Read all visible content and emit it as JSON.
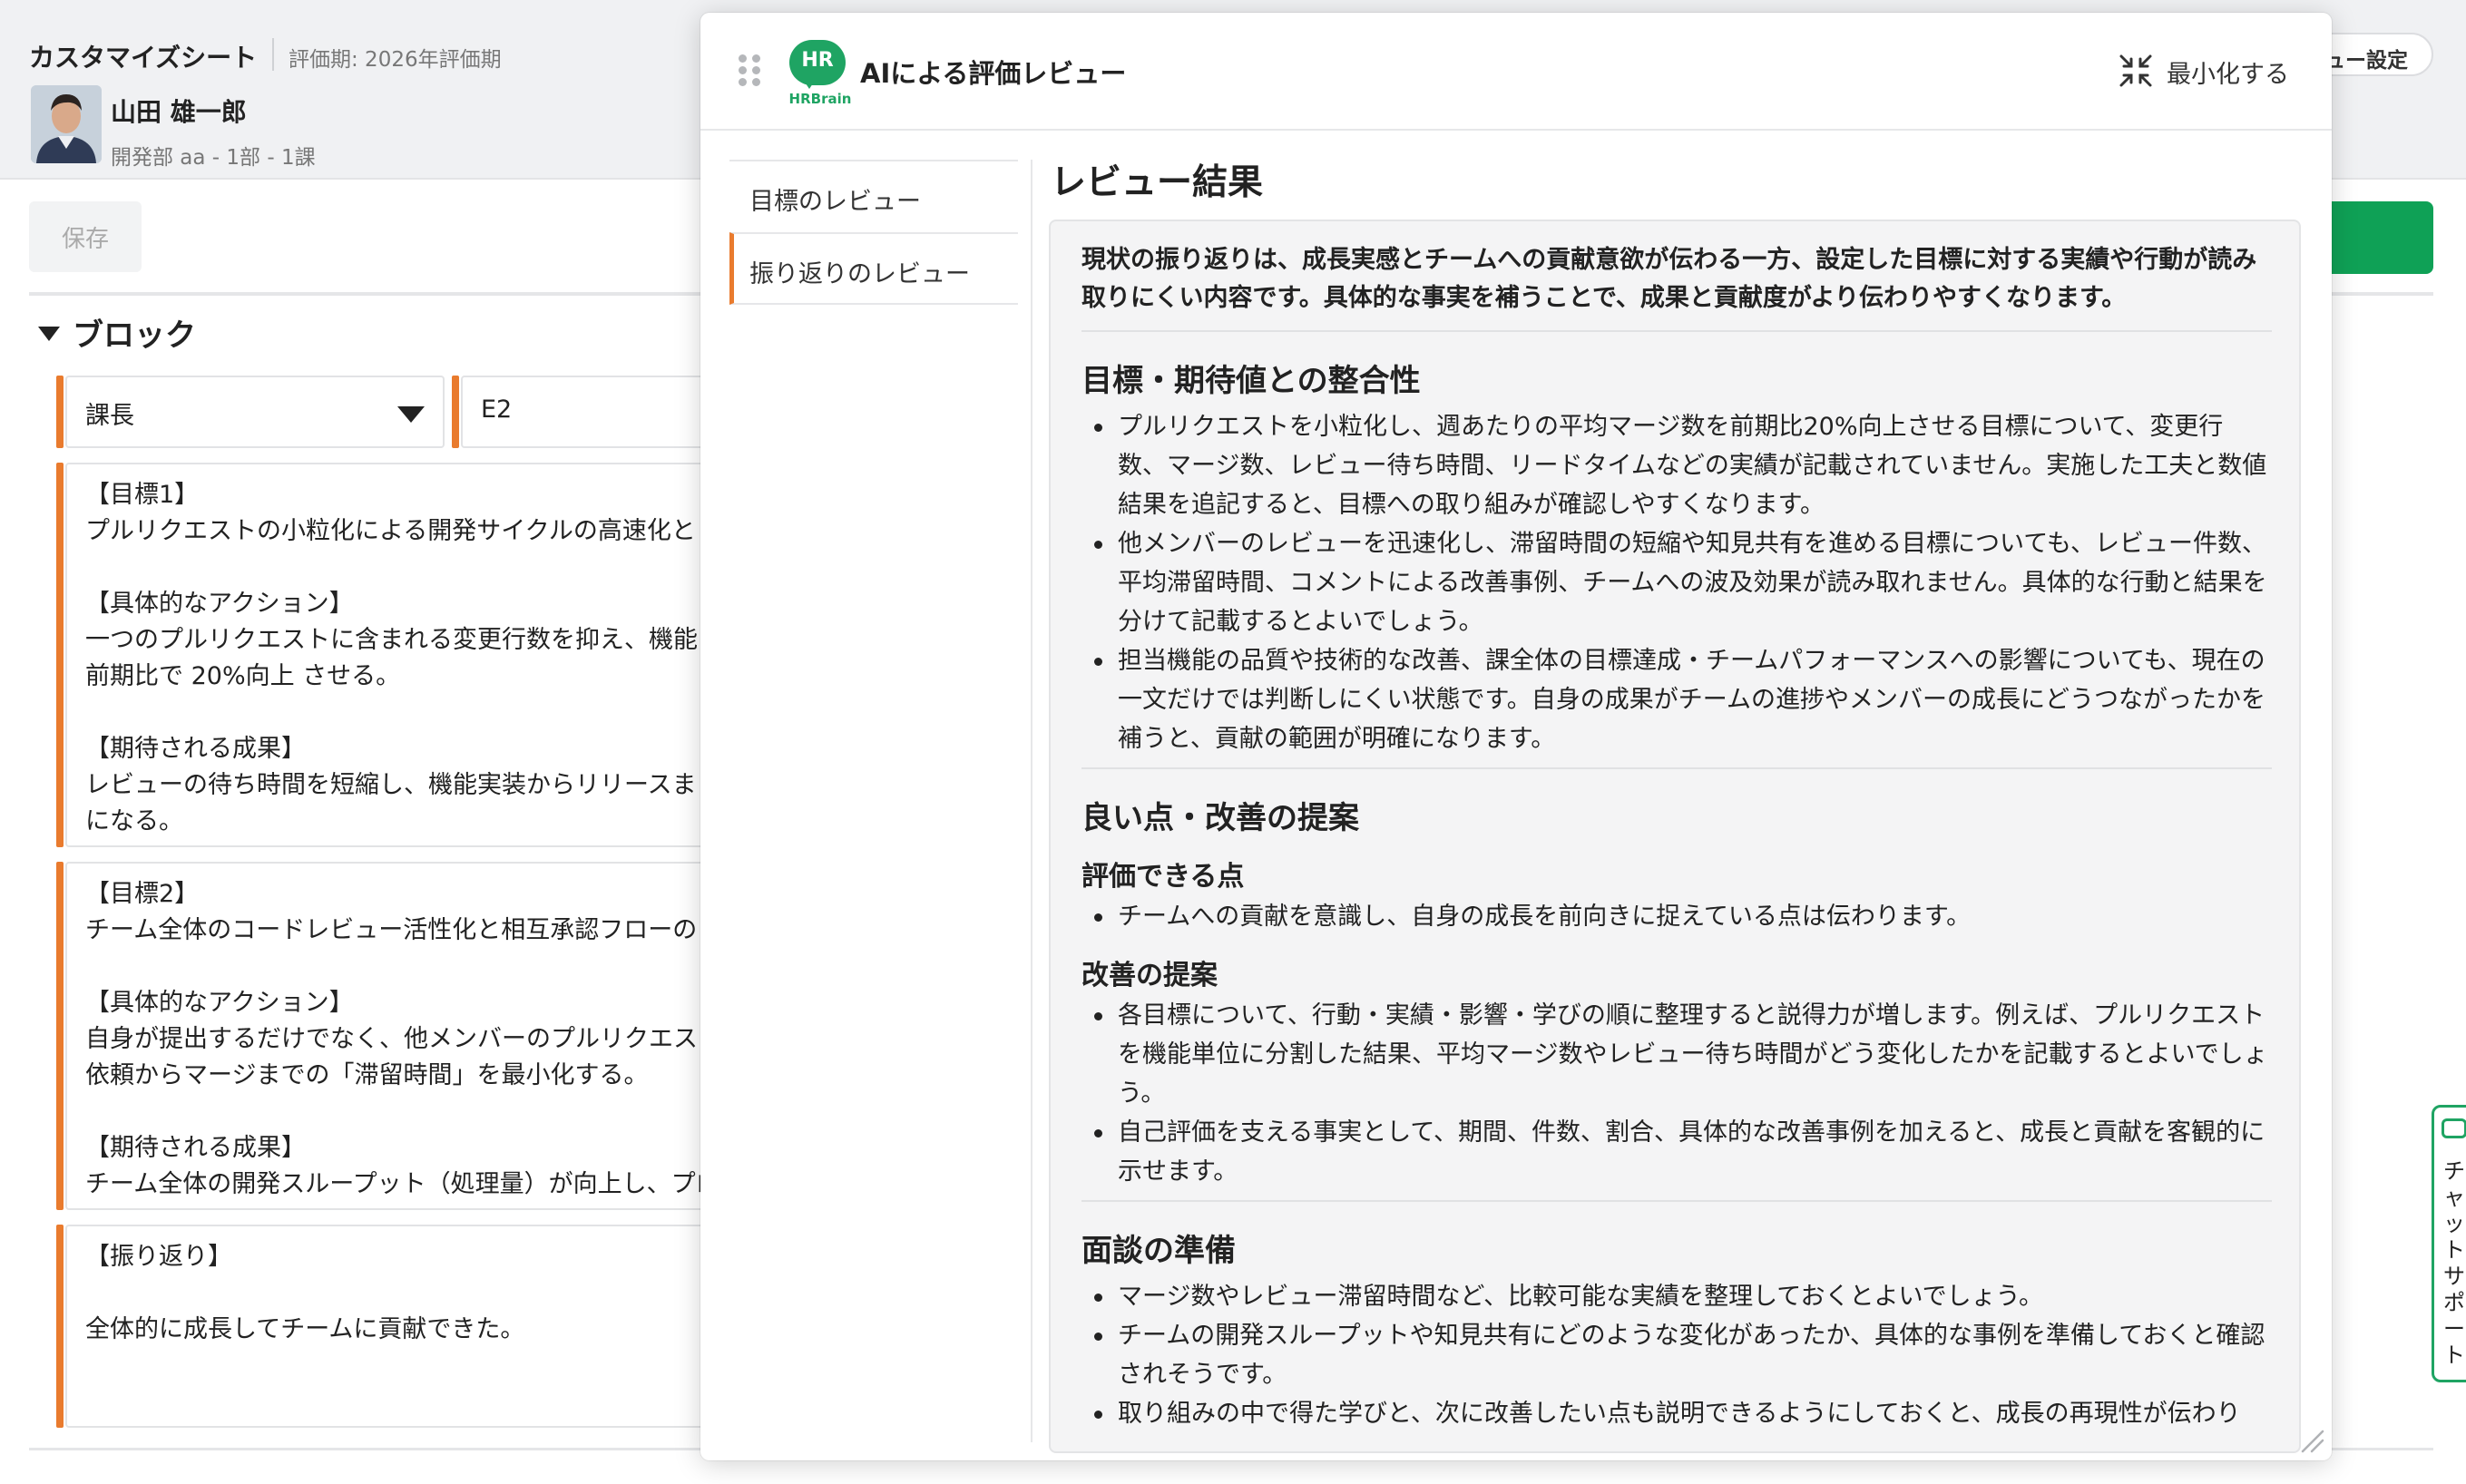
{
  "background_page": {
    "sheet_title": "カスタマイズシート",
    "period_label": "評価期: 2026年評価期",
    "user": {
      "name": "山田 雄一郎",
      "department": "開発部 aa - 1部 - 1課"
    },
    "save_label": "保存",
    "header_right_button_label": "ュー設定",
    "block_title": "ブロック",
    "role_select_value": "課長",
    "grade_value": "E2",
    "goal1_text": "【目標1】\nプルリクエストの小粒化による開発サイクルの高速化と\n\n【具体的なアクション】\n一つのプルリクエストに含まれる変更行数を抑え、機能\n前期比で 20%向上 させる。\n\n【期待される成果】\nレビューの待ち時間を短縮し、機能実装からリリースま\nになる。",
    "goal2_text": "【目標2】\nチーム全体のコードレビュー活性化と相互承認フローの\n\n【具体的なアクション】\n自身が提出するだけでなく、他メンバーのプルリクエス\n依頼からマージまでの「滞留時間」を最小化する。\n\n【期待される成果】\nチーム全体の開発スループット（処理量）が向上し、プロ",
    "reflection_text": "【振り返り】\n\n全体的に成長してチームに貢献できた。",
    "chat_support_label": "チャットサポート"
  },
  "modal": {
    "logo_text": "HR",
    "logo_word": "HRBrain",
    "title": "AIによる評価レビュー",
    "minimize_label": "最小化する",
    "nav_items": [
      {
        "label": "目標のレビュー"
      },
      {
        "label": "振り返りのレビュー"
      }
    ],
    "result_title": "レビュー結果",
    "summary": "現状の振り返りは、成長実感とチームへの貢献意欲が伝わる一方、設定した目標に対する実績や行動が読み取りにくい内容です。具体的な事実を補うことで、成果と貢献度がより伝わりやすくなります。",
    "section1": {
      "title": "目標・期待値との整合性",
      "bullets": [
        "プルリクエストを小粒化し、週あたりの平均マージ数を前期比20%向上させる目標について、変更行数、マージ数、レビュー待ち時間、リードタイムなどの実績が記載されていません。実施した工夫と数値結果を追記すると、目標への取り組みが確認しやすくなります。",
        "他メンバーのレビューを迅速化し、滞留時間の短縮や知見共有を進める目標についても、レビュー件数、平均滞留時間、コメントによる改善事例、チームへの波及効果が読み取れません。具体的な行動と結果を分けて記載するとよいでしょう。",
        "担当機能の品質や技術的な改善、課全体の目標達成・チームパフォーマンスへの影響についても、現在の一文だけでは判断しにくい状態です。自身の成果がチームの進捗やメンバーの成長にどうつながったかを補うと、貢献の範囲が明確になります。"
      ]
    },
    "section2": {
      "title": "良い点・改善の提案",
      "good_title": "評価できる点",
      "good_bullets": [
        "チームへの貢献を意識し、自身の成長を前向きに捉えている点は伝わります。"
      ],
      "improve_title": "改善の提案",
      "improve_bullets": [
        "各目標について、行動・実績・影響・学びの順に整理すると説得力が増します。例えば、プルリクエストを機能単位に分割した結果、平均マージ数やレビュー待ち時間がどう変化したかを記載するとよいでしょう。",
        "自己評価を支える事実として、期間、件数、割合、具体的な改善事例を加えると、成長と貢献を客観的に示せます。"
      ]
    },
    "section3": {
      "title": "面談の準備",
      "bullets": [
        "マージ数やレビュー滞留時間など、比較可能な実績を整理しておくとよいでしょう。",
        "チームの開発スループットや知見共有にどのような変化があったか、具体的な事例を準備しておくと確認されそうです。",
        "取り組みの中で得た学びと、次に改善したい点も説明できるようにしておくと、成長の再現性が伝わり"
      ]
    }
  }
}
